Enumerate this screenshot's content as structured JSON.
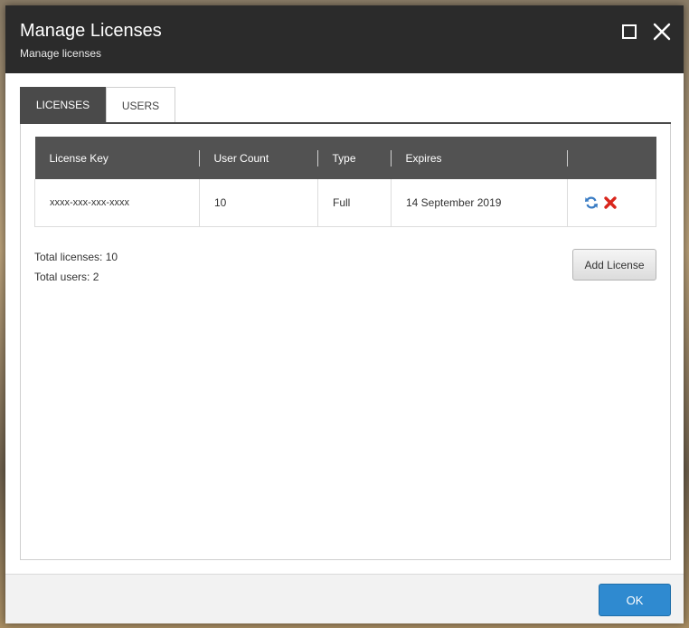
{
  "dialog": {
    "title": "Manage Licenses",
    "subtitle": "Manage licenses"
  },
  "tabs": [
    {
      "label": "LICENSES",
      "active": true
    },
    {
      "label": "USERS",
      "active": false
    }
  ],
  "table": {
    "columns": [
      "License Key",
      "User Count",
      "Type",
      "Expires",
      ""
    ],
    "rows": [
      {
        "license_key": "xxxx-xxx-xxx-xxxx",
        "user_count": "10",
        "type": "Full",
        "expires": "14 September 2019",
        "actions": [
          "refresh-icon",
          "delete-icon"
        ]
      }
    ]
  },
  "totals": {
    "licenses": "Total licenses: 10",
    "users": "Total users: 2"
  },
  "buttons": {
    "add_license": "Add License",
    "ok": "OK"
  },
  "colors": {
    "titlebar": "#2b2b2b",
    "active_tab": "#4a4a4a",
    "table_header": "#525252",
    "ok_button": "#2f8ad0",
    "refresh_icon": "#3a7cc4",
    "delete_icon": "#d9261c"
  }
}
